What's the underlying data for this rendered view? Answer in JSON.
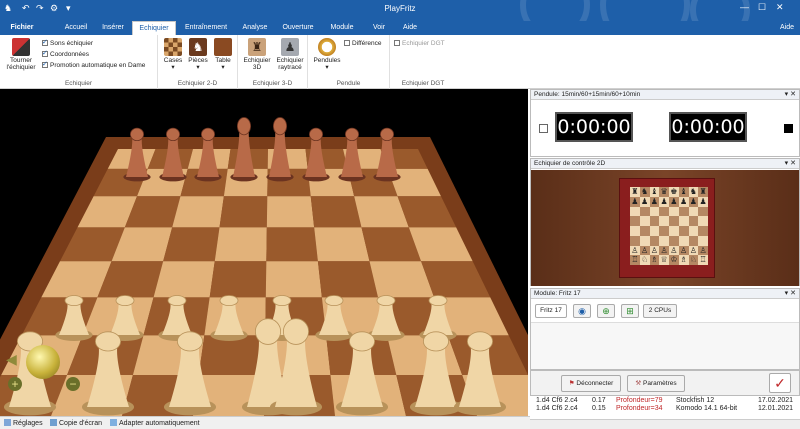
{
  "app": {
    "title": "PlayFritz"
  },
  "menu": {
    "file": "Fichier",
    "tabs": [
      "Accueil",
      "Insérer",
      "Echiquier",
      "Entraînement",
      "Analyse",
      "Ouverture",
      "Module",
      "Voir",
      "Aide"
    ],
    "active_tab": "Echiquier",
    "help": "Aide"
  },
  "ribbon": {
    "rotate_label_1": "Tourner",
    "rotate_label_2": "l'échiquier",
    "checks": [
      {
        "label": "Sons échiquier",
        "checked": true
      },
      {
        "label": "Coordonnées",
        "checked": true
      },
      {
        "label": "Promotion automatique en Dame",
        "checked": true
      }
    ],
    "group_echiquier": "Echiquier",
    "squares": "Cases",
    "pieces": "Pièces",
    "table": "Table",
    "group_2d": "Echiquier 2-D",
    "board3d_1": "Echiquier",
    "board3d_2": "3D",
    "raytrace_1": "Echiquier",
    "raytrace_2": "raytracé",
    "group_3d": "Echiquier 3-D",
    "clocks": "Pendules",
    "difference": "Différence",
    "group_clock": "Pendule",
    "dgt_board": "Echiquier DGT",
    "group_dgt": "Echiquier DGT"
  },
  "statusbar": {
    "settings": "Réglages",
    "screenshot": "Copie d'écran",
    "autofit": "Adapter automatiquement"
  },
  "clock_panel": {
    "title": "Pendule: 15min/60+15min/60+10min",
    "white_time": "0:00:00",
    "black_time": "0:00:00"
  },
  "board2d_panel": {
    "title": "Echiquier de contrôle 2D"
  },
  "engine_panel": {
    "title": "Module: Fritz 17",
    "engine_name": "Fritz 17",
    "cpus": "2 CPUs",
    "disconnect": "Déconnecter",
    "params": "Paramètres"
  },
  "lines": [
    {
      "move": "1.d4 Cf6 2.c4",
      "score": "0.17",
      "depth": "Profondeur=79",
      "engine": "Stockfish 12",
      "date": "17.02.2021"
    },
    {
      "move": "1.d4 Cf6 2.c4",
      "score": "0.15",
      "depth": "Profondeur=34",
      "engine": "Komodo 14.1 64-bit",
      "date": "12.01.2021"
    }
  ],
  "colors": {
    "accent": "#1e5fa9",
    "depth": "#c0282a"
  }
}
